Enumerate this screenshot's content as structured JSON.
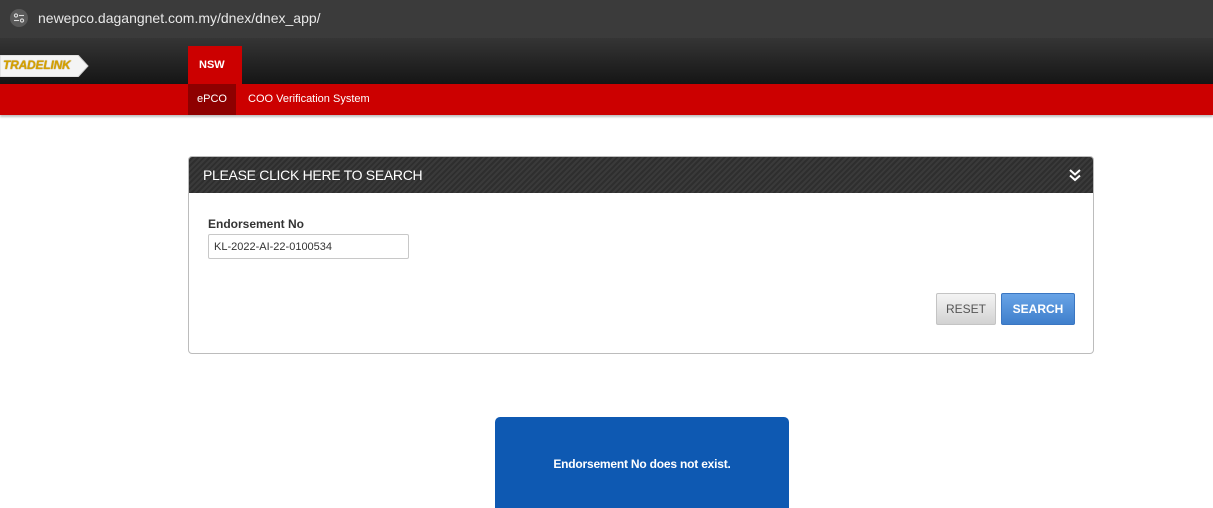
{
  "browser": {
    "url": "newepco.dagangnet.com.my/dnex/dnex_app/",
    "site_info_icon": "tune-icon"
  },
  "nav": {
    "brand": "TRADELINK",
    "tab": "NSW",
    "sub_items": [
      "ePCO",
      "COO Verification System"
    ]
  },
  "search_panel": {
    "title": "PLEASE CLICK HERE TO SEARCH",
    "collapse_icon": "double-chevron-down-icon",
    "field_label": "Endorsement No",
    "field_value": "KL-2022-AI-22-0100534",
    "reset_label": "RESET",
    "search_label": "SEARCH"
  },
  "alert": {
    "message": "Endorsement No does not exist."
  },
  "colors": {
    "nav_red": "#cc0000",
    "nav_red_dark": "#8e0000",
    "alert_blue": "#0e59b2",
    "search_blue": "#4a8bd8",
    "brand_gold": "#d6a100"
  }
}
